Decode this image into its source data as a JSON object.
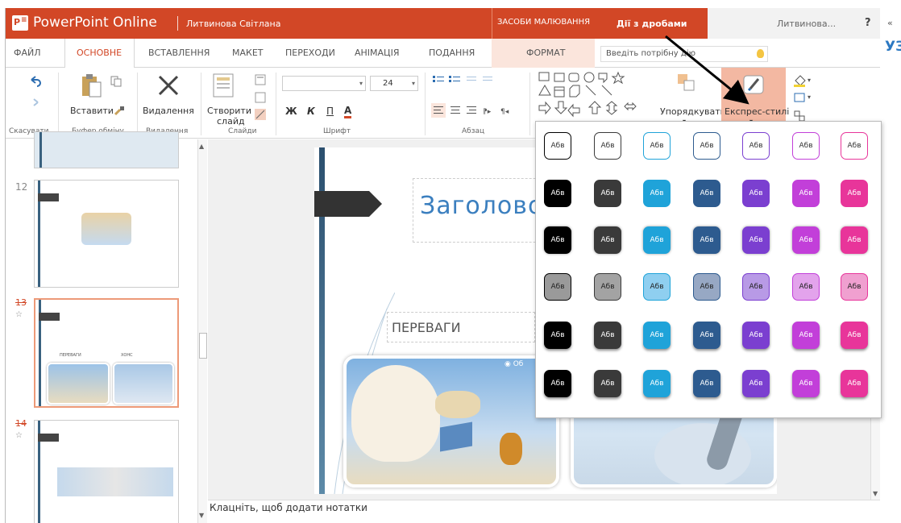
{
  "titlebar": {
    "app_title": "PowerPoint Online",
    "user_title": "Литвинова Світлана",
    "context_drawing": "ЗАСОБИ МАЛЮВАННЯ",
    "context_fractions": "Дії з дробами",
    "user_name": "Литвинова...",
    "help": "?"
  },
  "tabs": [
    {
      "label": "ФАЙЛ"
    },
    {
      "label": "ОСНОВНЕ"
    },
    {
      "label": "ВСТАВЛЕННЯ"
    },
    {
      "label": "МАКЕТ"
    },
    {
      "label": "ПЕРЕХОДИ"
    },
    {
      "label": "АНІМАЦІЯ"
    },
    {
      "label": "ПОДАННЯ"
    },
    {
      "label": "ФОРМАТ"
    }
  ],
  "tell_me_placeholder": "Введіть потрібну дію",
  "ribbon": {
    "paste": "Вставити",
    "delete": "Видалення",
    "new_slide_1": "Створити",
    "new_slide_2": "слайд",
    "font_size": "24",
    "bold": "Ж",
    "italic": "К",
    "underline": "П",
    "font_color": "А",
    "arrange": "Упорядкувати",
    "quick_styles": "Експрес-стилі",
    "groups": {
      "undo": "Скасувати",
      "clipboard": "Буфер обміну",
      "delete": "Видалення",
      "slides": "Слайди",
      "font": "Шрифт",
      "paragraph": "Абзац"
    }
  },
  "thumbnails": [
    {
      "number": "12"
    },
    {
      "number": "13",
      "t1": "ПЕРЕВАГИ",
      "t2": "ХОНС"
    },
    {
      "number": "14"
    }
  ],
  "slide": {
    "title": "Заголовок",
    "subtitle": "ПЕРЕВАГИ",
    "badge": "Об"
  },
  "notes_placeholder": "Клацніть, щоб додати нотатки",
  "side_panel": {
    "collapse": "«",
    "text": "УЗ"
  },
  "gallery": {
    "swatch_label": "Абв",
    "colors": [
      "#000000",
      "#3a3a3a",
      "#1fa3d9",
      "#2d5b8f",
      "#7b3fd0",
      "#c23fd9",
      "#e8359a"
    ],
    "pastel": [
      "#9a9a9a",
      "#a3a3a3",
      "#8fcff0",
      "#97a8c4",
      "#b89ae6",
      "#e3a3ec",
      "#f0a0d0"
    ]
  }
}
